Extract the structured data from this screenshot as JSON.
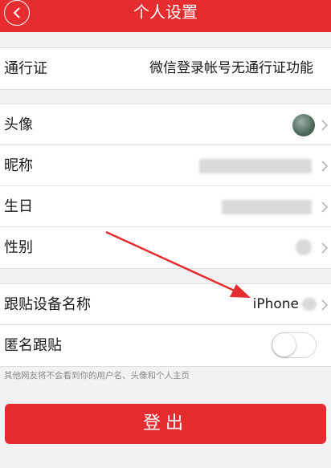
{
  "header": {
    "title": "个人设置",
    "back_icon": "chevron-left-icon"
  },
  "pass_section": {
    "label": "通行证",
    "value": "微信登录帐号无通行证功能"
  },
  "profile_section": {
    "avatar_label": "头像",
    "nickname_label": "昵称",
    "birthday_label": "生日",
    "gender_label": "性别"
  },
  "device_section": {
    "device_label": "跟贴设备名称",
    "device_value": "iPhone",
    "anonymous_label": "匿名跟贴",
    "anonymous_enabled": false
  },
  "footnote": "其他网友将不会看到你的用户名、头像和个人主页",
  "logout_label": "登出",
  "colors": {
    "brand_red": "#e52d2f",
    "background": "#f2f2f4"
  }
}
